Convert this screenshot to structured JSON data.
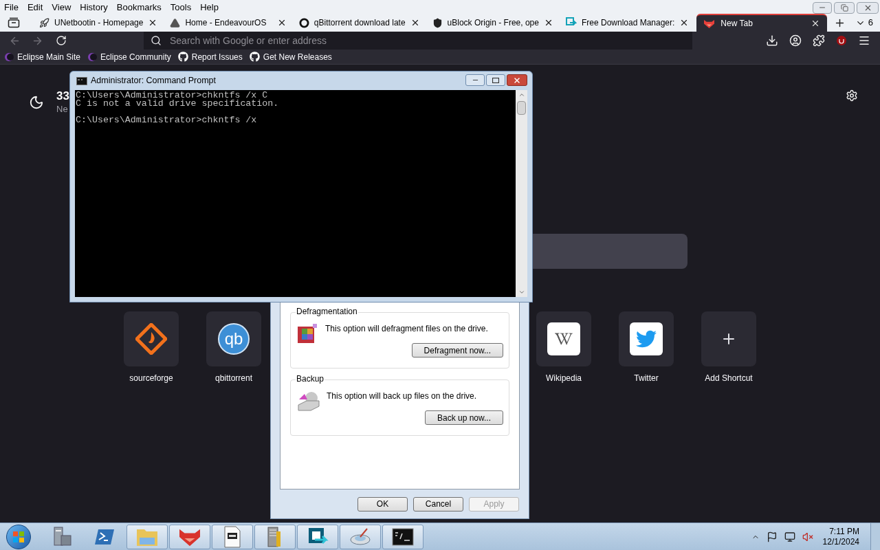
{
  "browser": {
    "menu": [
      "File",
      "Edit",
      "View",
      "History",
      "Bookmarks",
      "Tools",
      "Help"
    ],
    "tabs": [
      {
        "title": "UNetbootin - Homepage",
        "kind": "rocket",
        "selected": false
      },
      {
        "title": "Home - EndeavourOS",
        "kind": "triangle",
        "selected": false
      },
      {
        "title": "qBittorrent download late",
        "kind": "ring",
        "selected": false
      },
      {
        "title": "uBlock Origin - Free, ope",
        "kind": "shield",
        "selected": false
      },
      {
        "title": "Free Download Manager:",
        "kind": "fdm",
        "selected": false
      },
      {
        "title": "New Tab",
        "kind": "fox",
        "selected": true
      }
    ],
    "tab_count": "6",
    "address_placeholder": "Search with Google or enter address",
    "bookmarks": [
      {
        "label": "Eclipse Main Site",
        "kind": "eclipse"
      },
      {
        "label": "Eclipse Community",
        "kind": "eclipse"
      },
      {
        "label": "Report Issues",
        "kind": "github"
      },
      {
        "label": "Get New Releases",
        "kind": "github"
      }
    ],
    "new_tab": {
      "weather_temp": "33",
      "weather_label": "Ne",
      "shortcuts_left": [
        {
          "label": "sourceforge",
          "kind": "sourceforge"
        },
        {
          "label": "qbittorrent",
          "kind": "qb",
          "logo_text": "qb"
        }
      ],
      "shortcuts_right": [
        {
          "label": "Wikipedia",
          "kind": "wikipedia"
        },
        {
          "label": "Twitter",
          "kind": "twitter"
        },
        {
          "label": "Add Shortcut",
          "kind": "add"
        }
      ]
    }
  },
  "command_prompt": {
    "title": "Administrator: Command Prompt",
    "output": [
      "C:\\Users\\Administrator>chkntfs /x C",
      "C is not a valid drive specification."
    ],
    "prompt": "C:\\Users\\Administrator>chkntfs /x"
  },
  "properties_dialog": {
    "groups": [
      {
        "title": "Defragmentation",
        "text": "This option will defragment files on the drive.",
        "button": "Defragment now...",
        "kind": "defrag"
      },
      {
        "title": "Backup",
        "text": "This option will back up files on the drive.",
        "button": "Back up now...",
        "kind": "backup"
      }
    ],
    "buttons": [
      {
        "label": "OK",
        "disabled": false
      },
      {
        "label": "Cancel",
        "disabled": false
      },
      {
        "label": "Apply",
        "disabled": true
      }
    ]
  },
  "taskbar": {
    "items": [
      {
        "kind": "server",
        "running": false
      },
      {
        "kind": "powershell",
        "running": false
      },
      {
        "kind": "folder",
        "running": true
      },
      {
        "kind": "fox",
        "running": true
      },
      {
        "kind": "notepad",
        "running": true
      },
      {
        "kind": "archive",
        "running": true
      },
      {
        "kind": "fdm",
        "running": true
      },
      {
        "kind": "mouse",
        "running": true
      },
      {
        "kind": "console",
        "running": true
      }
    ],
    "time": "7:11 PM",
    "date": "12/1/2024"
  }
}
